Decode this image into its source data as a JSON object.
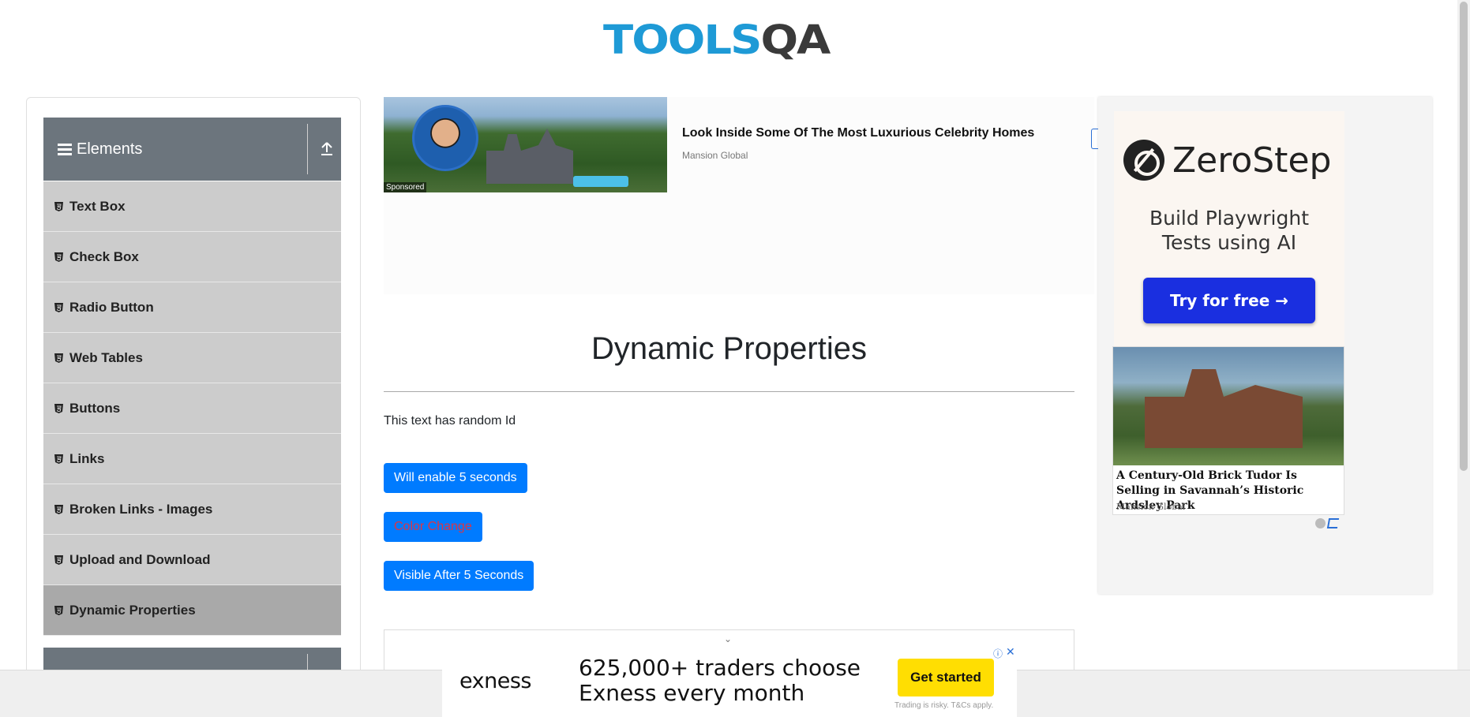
{
  "header": {
    "logo_tools": "TOOLS",
    "logo_qa": "QA"
  },
  "sidebar": {
    "group_title": "Elements",
    "items": [
      {
        "label": "Text Box"
      },
      {
        "label": "Check Box"
      },
      {
        "label": "Radio Button"
      },
      {
        "label": "Web Tables"
      },
      {
        "label": "Buttons"
      },
      {
        "label": "Links"
      },
      {
        "label": "Broken Links - Images"
      },
      {
        "label": "Upload and Download"
      },
      {
        "label": "Dynamic Properties"
      }
    ],
    "active_item": "Dynamic Properties"
  },
  "top_ad": {
    "headline": "Look Inside Some Of The Most Luxurious Celebrity Homes",
    "source": "Mansion Global",
    "sponsored_label": "Sponsored"
  },
  "main": {
    "title": "Dynamic Properties",
    "random_text": "This text has random Id",
    "buttons": {
      "enable_after": "Will enable 5 seconds",
      "color_change": "Color Change",
      "visible_after": "Visible After 5 Seconds"
    }
  },
  "right_ad": {
    "brand": "ZeroStep",
    "tagline_line1": "Build Playwright",
    "tagline_line2": "Tests using AI",
    "cta": "Try for free →",
    "article_title": "A Century-Old Brick Tudor Is Selling in Savannah’s Historic Ardsley Park",
    "article_source": "Mansion Global"
  },
  "bottom_ad": {
    "brand": "exness",
    "headline_line1": "625,000+ traders choose",
    "headline_line2": "Exness every month",
    "cta": "Get started",
    "disclaimer": "Trading is risky. T&Cs apply."
  },
  "colors": {
    "primary_button": "#007bff",
    "color_change_text": "#dc3545",
    "sidebar_header": "#6c757d",
    "sidebar_item": "#cccccc",
    "sidebar_active": "#a9a9a9",
    "logo_blue": "#1e9ad6"
  }
}
